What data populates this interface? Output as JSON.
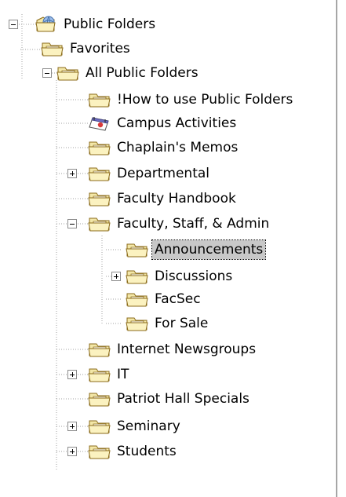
{
  "tree": {
    "root": {
      "label": "Public Folders",
      "icon": "globe-folder-icon",
      "expanded": true
    },
    "favorites": {
      "label": "Favorites",
      "icon": "folder-icon"
    },
    "all_public_folders": {
      "label": "All Public Folders",
      "icon": "folder-icon",
      "expanded": true,
      "children": [
        {
          "label": "!How to use Public Folders",
          "icon": "folder-icon",
          "has_children": false
        },
        {
          "label": "Campus Activities",
          "icon": "calendar-icon",
          "has_children": false
        },
        {
          "label": "Chaplain's Memos",
          "icon": "folder-icon",
          "has_children": false
        },
        {
          "label": "Departmental",
          "icon": "folder-icon",
          "has_children": true,
          "expanded": false
        },
        {
          "label": "Faculty Handbook",
          "icon": "folder-icon",
          "has_children": false
        },
        {
          "label": "Faculty, Staff, & Admin",
          "icon": "folder-icon",
          "has_children": true,
          "expanded": true,
          "children": [
            {
              "label": "Announcements",
              "icon": "folder-icon",
              "selected": true,
              "has_children": false
            },
            {
              "label": "Discussions",
              "icon": "folder-icon",
              "has_children": true,
              "expanded": false
            },
            {
              "label": "FacSec",
              "icon": "folder-icon",
              "has_children": false
            },
            {
              "label": "For Sale",
              "icon": "folder-icon",
              "has_children": false
            }
          ]
        },
        {
          "label": "Internet Newsgroups",
          "icon": "folder-icon",
          "has_children": false
        },
        {
          "label": "IT",
          "icon": "folder-icon",
          "has_children": true,
          "expanded": false
        },
        {
          "label": "Patriot Hall Specials",
          "icon": "folder-icon",
          "has_children": false
        },
        {
          "label": "Seminary",
          "icon": "folder-icon",
          "has_children": true,
          "expanded": false
        },
        {
          "label": "Students",
          "icon": "folder-icon",
          "has_children": true,
          "expanded": false
        }
      ]
    }
  },
  "colors": {
    "folder_fill": "#f3e7a8",
    "folder_stroke": "#8b6b1a",
    "selection_bg": "#c8c8c8",
    "tree_line": "#a0a0a0"
  }
}
